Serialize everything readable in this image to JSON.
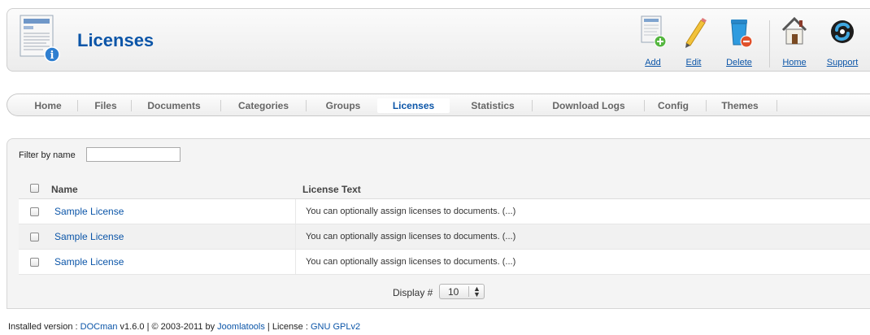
{
  "header": {
    "title": "Licenses"
  },
  "toolbar": {
    "add_label": "Add",
    "edit_label": "Edit",
    "delete_label": "Delete",
    "home_label": "Home",
    "support_label": "Support"
  },
  "nav": {
    "tabs": [
      {
        "label": "Home",
        "active": false
      },
      {
        "label": "Files",
        "active": false
      },
      {
        "label": "Documents",
        "active": false
      },
      {
        "label": "Categories",
        "active": false
      },
      {
        "label": "Groups",
        "active": false
      },
      {
        "label": "Licenses",
        "active": true
      },
      {
        "label": "Statistics",
        "active": false
      },
      {
        "label": "Download Logs",
        "active": false
      },
      {
        "label": "Config",
        "active": false
      },
      {
        "label": "Themes",
        "active": false
      }
    ]
  },
  "filter": {
    "label": "Filter by name",
    "value": ""
  },
  "table": {
    "columns": [
      "Name",
      "License Text"
    ],
    "rows": [
      {
        "name": "Sample License",
        "text": "You can optionally assign licenses to documents. (...)"
      },
      {
        "name": "Sample License",
        "text": "You can optionally assign licenses to documents. (...)"
      },
      {
        "name": "Sample License",
        "text": "You can optionally assign licenses to documents. (...)"
      }
    ]
  },
  "pagination": {
    "display_label": "Display #",
    "display_value": "10"
  },
  "footer": {
    "prefix": "Installed version : ",
    "product": "DOCman",
    "version_text": " v1.6.0 | © 2003-2011 by ",
    "company": "Joomlatools",
    "license_text": " | License : ",
    "license": "GNU GPLv2"
  },
  "colors": {
    "link": "#0b55a8",
    "title": "#0b55a8"
  }
}
